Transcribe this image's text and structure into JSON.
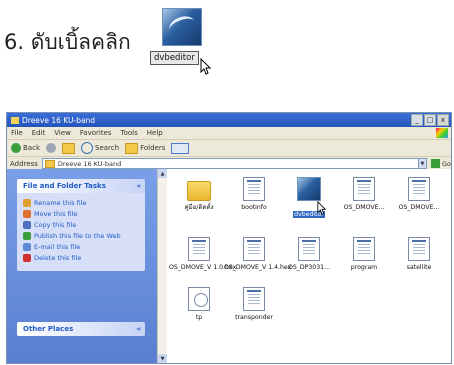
{
  "instruction": {
    "step_text": "6. ดับเบิ้ลคลิก",
    "icon_label": "dvbeditor"
  },
  "window": {
    "title": "Dreeve 16 KU-band",
    "controls": [
      "_",
      "□",
      "x"
    ],
    "menu": [
      "File",
      "Edit",
      "View",
      "Favorites",
      "Tools",
      "Help"
    ],
    "toolbar": {
      "back": "Back",
      "search": "Search",
      "folders": "Folders"
    },
    "address": {
      "label": "Address",
      "value": "Dreeve 16 KU-band",
      "go": "Go"
    }
  },
  "tasks_panel": {
    "title": "File and Folder Tasks",
    "items": [
      {
        "label": "Rename this file",
        "icon": "rename-icon",
        "color": "#e0a030"
      },
      {
        "label": "Move this file",
        "icon": "move-icon",
        "color": "#e07030"
      },
      {
        "label": "Copy this file",
        "icon": "copy-icon",
        "color": "#5070c0"
      },
      {
        "label": "Publish this file to the Web",
        "icon": "globe-icon",
        "color": "#3a9e3a"
      },
      {
        "label": "E-mail this file",
        "icon": "email-icon",
        "color": "#5a8ad8"
      },
      {
        "label": "Delete this file",
        "icon": "delete-icon",
        "color": "#d03030"
      }
    ]
  },
  "other_places": {
    "title": "Other Places"
  },
  "files": [
    {
      "name": "คู่มือ/ติดตั้ง",
      "kind": "folder"
    },
    {
      "name": "bootinfo",
      "kind": "doc"
    },
    {
      "name": "dvbeditor",
      "kind": "app",
      "selected": true
    },
    {
      "name": "OS_DMOVE...",
      "kind": "doc"
    },
    {
      "name": "OS_DMOVE...",
      "kind": "doc"
    },
    {
      "name": "OS_DMOVE_V 1.0.hex",
      "kind": "doc"
    },
    {
      "name": "OS_DMOVE_V 1.4.hex",
      "kind": "doc"
    },
    {
      "name": "OS_DP3031...",
      "kind": "doc"
    },
    {
      "name": "program",
      "kind": "doc"
    },
    {
      "name": "satellite",
      "kind": "doc"
    },
    {
      "name": "tp",
      "kind": "ini"
    },
    {
      "name": "transponder",
      "kind": "doc"
    }
  ]
}
